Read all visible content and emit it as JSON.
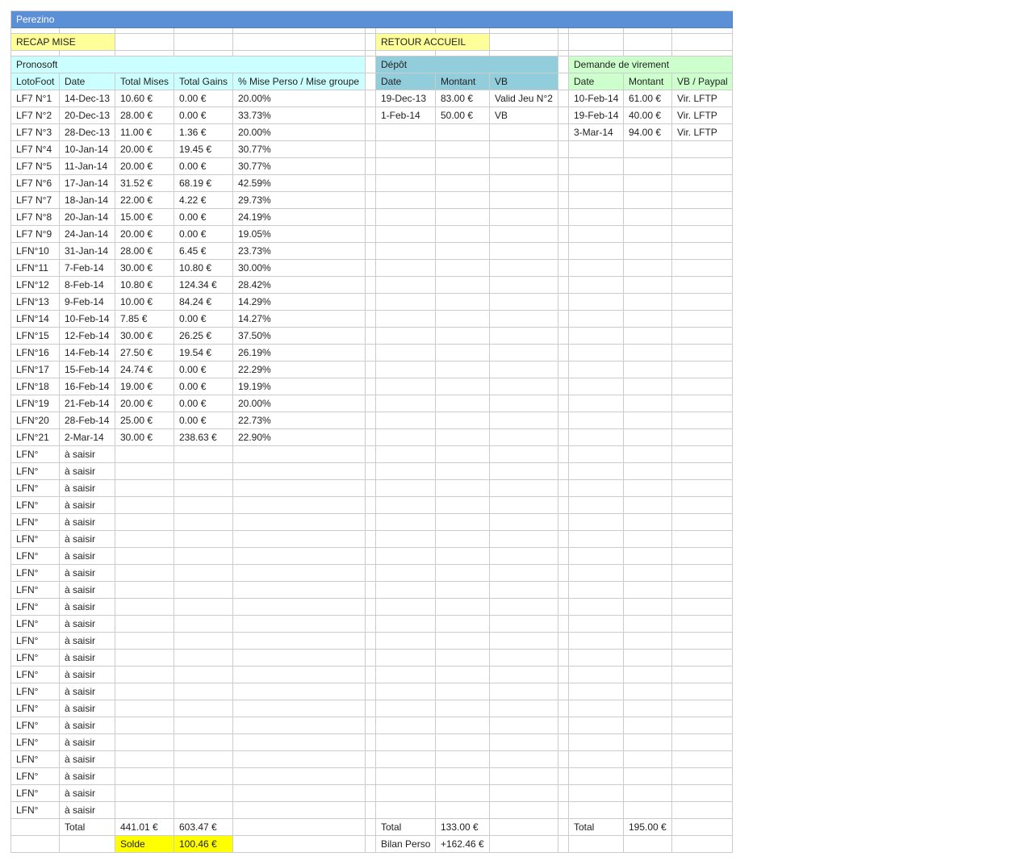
{
  "sheet": {
    "title": "Perezino"
  },
  "nav": {
    "recap_label": "RECAP MISE",
    "home_label": "RETOUR ACCUEIL"
  },
  "pronosoft": {
    "title": "Pronosoft",
    "headers": [
      "LotoFoot",
      "Date",
      "Total Mises",
      "Total Gains",
      "% Mise Perso / Mise groupe"
    ],
    "rows": [
      [
        "LF7 N°1",
        "14-Dec-13",
        "10.60 €",
        "0.00 €",
        "20.00%"
      ],
      [
        "LF7 N°2",
        "20-Dec-13",
        "28.00 €",
        "0.00 €",
        "33.73%"
      ],
      [
        "LF7 N°3",
        "28-Dec-13",
        "11.00 €",
        "1.36 €",
        "20.00%"
      ],
      [
        "LF7 N°4",
        "10-Jan-14",
        "20.00 €",
        "19.45 €",
        "30.77%"
      ],
      [
        "LF7 N°5",
        "11-Jan-14",
        "20.00 €",
        "0.00 €",
        "30.77%"
      ],
      [
        "LF7 N°6",
        "17-Jan-14",
        "31.52 €",
        "68.19 €",
        "42.59%"
      ],
      [
        "LF7 N°7",
        "18-Jan-14",
        "22.00 €",
        "4.22 €",
        "29.73%"
      ],
      [
        "LF7 N°8",
        "20-Jan-14",
        "15.00 €",
        "0.00 €",
        "24.19%"
      ],
      [
        "LF7 N°9",
        "24-Jan-14",
        "20.00 €",
        "0.00 €",
        "19.05%"
      ],
      [
        "LFN°10",
        "31-Jan-14",
        "28.00 €",
        "6.45 €",
        "23.73%"
      ],
      [
        "LFN°11",
        "7-Feb-14",
        "30.00 €",
        "10.80 €",
        "30.00%"
      ],
      [
        "LFN°12",
        "8-Feb-14",
        "10.80 €",
        "124.34 €",
        "28.42%"
      ],
      [
        "LFN°13",
        "9-Feb-14",
        "10.00 €",
        "84.24 €",
        "14.29%"
      ],
      [
        "LFN°14",
        "10-Feb-14",
        "7.85 €",
        "0.00 €",
        "14.27%"
      ],
      [
        "LFN°15",
        "12-Feb-14",
        "30.00 €",
        "26.25 €",
        "37.50%"
      ],
      [
        "LFN°16",
        "14-Feb-14",
        "27.50 €",
        "19.54 €",
        "26.19%"
      ],
      [
        "LFN°17",
        "15-Feb-14",
        "24.74 €",
        "0.00 €",
        "22.29%"
      ],
      [
        "LFN°18",
        "16-Feb-14",
        "19.00 €",
        "0.00 €",
        "19.19%"
      ],
      [
        "LFN°19",
        "21-Feb-14",
        "20.00 €",
        "0.00 €",
        "20.00%"
      ],
      [
        "LFN°20",
        "28-Feb-14",
        "25.00 €",
        "0.00 €",
        "22.73%"
      ],
      [
        "LFN°21",
        "2-Mar-14",
        "30.00 €",
        "238.63 €",
        "22.90%"
      ],
      [
        "LFN°",
        "à saisir"
      ],
      [
        "LFN°",
        "à saisir"
      ],
      [
        "LFN°",
        "à saisir"
      ],
      [
        "LFN°",
        "à saisir"
      ],
      [
        "LFN°",
        "à saisir"
      ],
      [
        "LFN°",
        "à saisir"
      ],
      [
        "LFN°",
        "à saisir"
      ],
      [
        "LFN°",
        "à saisir"
      ],
      [
        "LFN°",
        "à saisir"
      ],
      [
        "LFN°",
        "à saisir"
      ],
      [
        "LFN°",
        "à saisir"
      ],
      [
        "LFN°",
        "à saisir"
      ],
      [
        "LFN°",
        "à saisir"
      ],
      [
        "LFN°",
        "à saisir"
      ],
      [
        "LFN°",
        "à saisir"
      ],
      [
        "LFN°",
        "à saisir"
      ],
      [
        "LFN°",
        "à saisir"
      ],
      [
        "LFN°",
        "à saisir"
      ],
      [
        "LFN°",
        "à saisir"
      ],
      [
        "LFN°",
        "à saisir"
      ],
      [
        "LFN°",
        "à saisir"
      ],
      [
        "LFN°",
        "à saisir"
      ]
    ],
    "total": {
      "label": "Total",
      "mises": "441.01 €",
      "gains": "603.47 €"
    },
    "solde": {
      "label": "Solde",
      "value": "100.46 €"
    }
  },
  "depot": {
    "title": "Dépôt",
    "headers": [
      "Date",
      "Montant",
      "VB"
    ],
    "rows": [
      [
        "19-Dec-13",
        "83.00 €",
        "Valid Jeu N°2"
      ],
      [
        "1-Feb-14",
        "50.00 €",
        "VB"
      ]
    ],
    "total": {
      "label": "Total",
      "value": "133.00 €"
    },
    "bilan": {
      "label": "Bilan Perso",
      "value": "+162.46 €"
    }
  },
  "virement": {
    "title": "Demande de virement",
    "headers": [
      "Date",
      "Montant",
      "VB / Paypal"
    ],
    "rows": [
      [
        "10-Feb-14",
        "61.00 €",
        "Vir. LFTP"
      ],
      [
        "19-Feb-14",
        "40.00 €",
        "Vir. LFTP"
      ],
      [
        "3-Mar-14",
        "94.00 €",
        "Vir. LFTP"
      ]
    ],
    "total": {
      "label": "Total",
      "value": "195.00 €"
    }
  },
  "colors": {
    "title_bar": "#5b8fd6",
    "label_yellow": "#ffff99",
    "pronosoft_cyan": "#ccffff",
    "depot_blue": "#92cddc",
    "virement_green": "#ccffcc",
    "solde_yellow": "#ffff00",
    "gridline": "#cccccc"
  }
}
